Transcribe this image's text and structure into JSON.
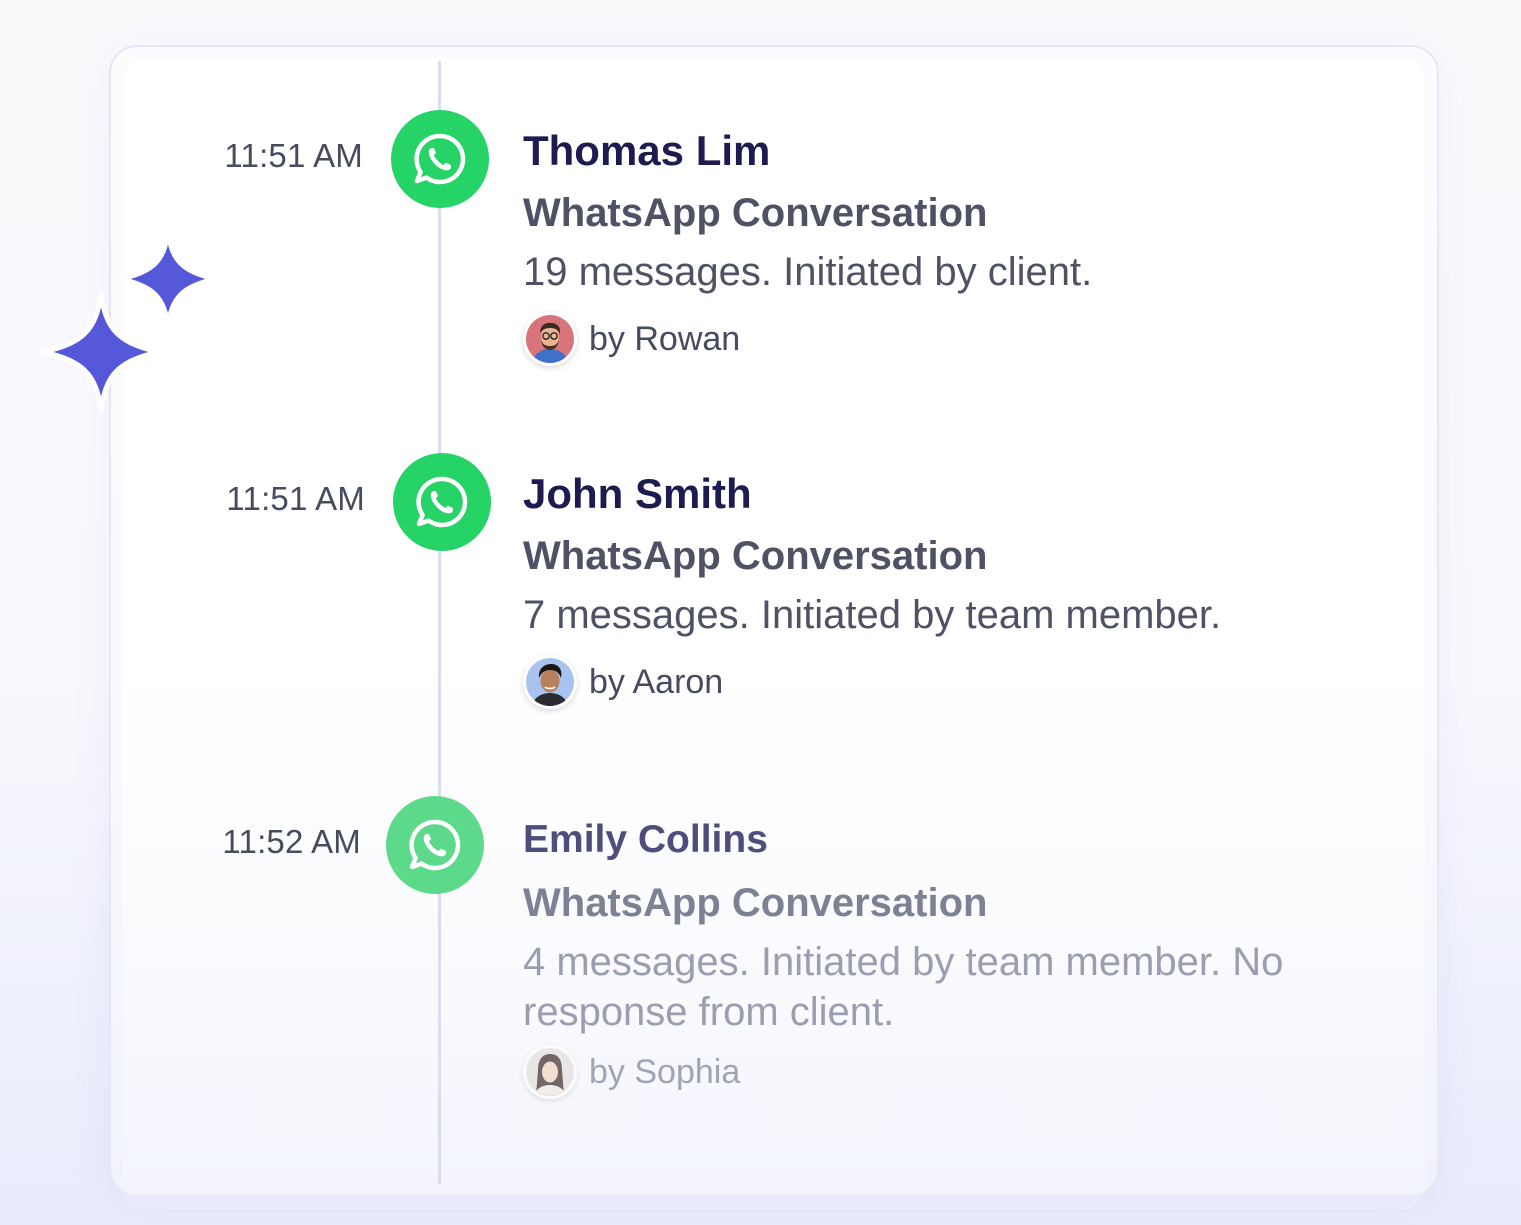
{
  "colors": {
    "whatsapp_green": "#25d366",
    "name_color": "#1d1b4f",
    "text_gray": "#4e5264",
    "sparkle": "#5558d9"
  },
  "timeline": [
    {
      "time": "11:51 AM",
      "icon": "whatsapp-icon",
      "name": "Thomas Lim",
      "type": "WhatsApp Conversation",
      "description": "19 messages. Initiated by client.",
      "by": "by Rowan"
    },
    {
      "time": "11:51 AM",
      "icon": "whatsapp-icon",
      "name": "John Smith",
      "type": "WhatsApp Conversation",
      "description": "7 messages. Initiated by team member.",
      "by": "by Aaron"
    },
    {
      "time": "11:52 AM",
      "icon": "whatsapp-icon",
      "name": "Emily Collins",
      "type": "WhatsApp Conversation",
      "description": "4 messages. Initiated by team member. No response from client.",
      "by": "by Sophia"
    }
  ]
}
